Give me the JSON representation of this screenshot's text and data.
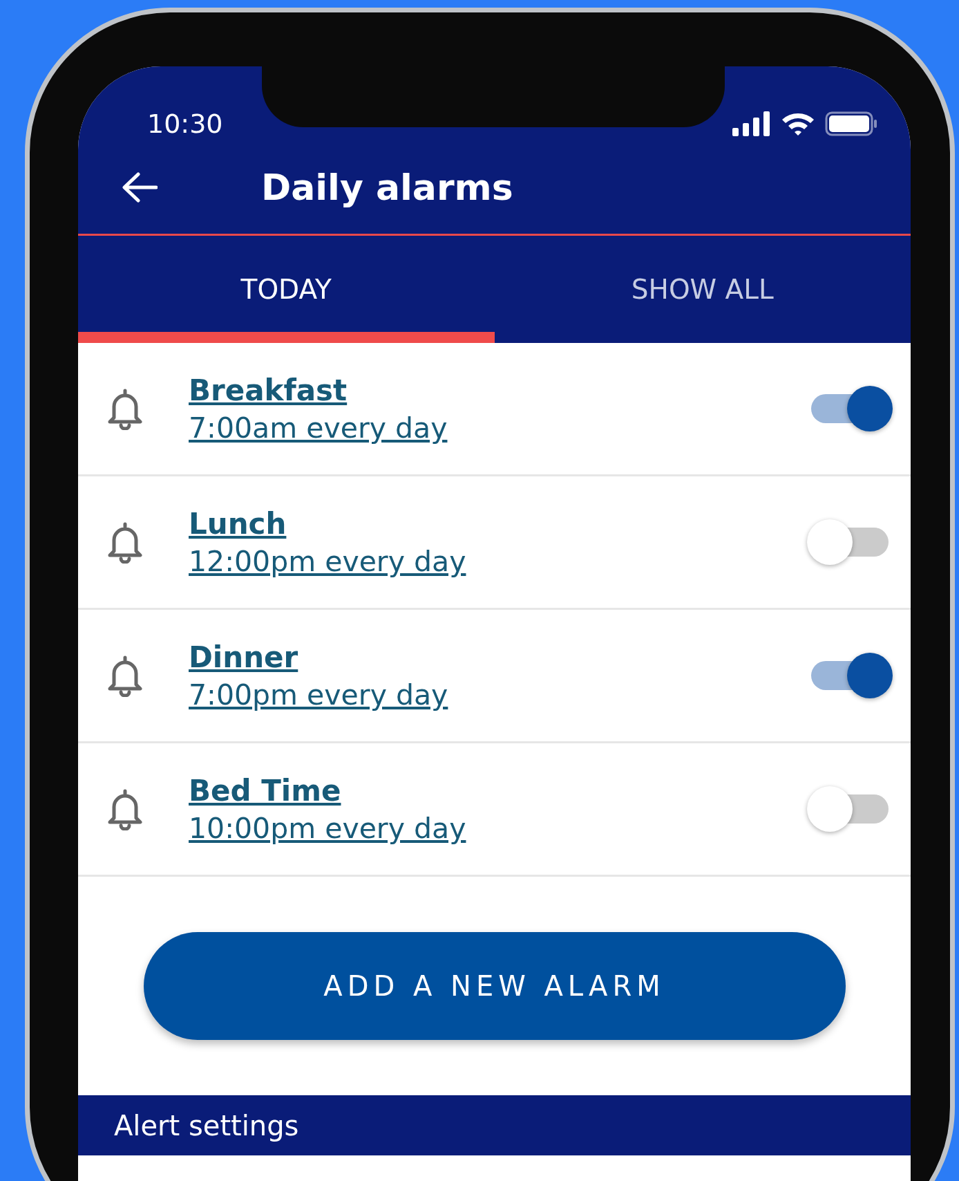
{
  "status_bar": {
    "time": "10:30"
  },
  "header": {
    "title": "Daily alarms"
  },
  "tabs": [
    {
      "label": "TODAY",
      "selected": true
    },
    {
      "label": "SHOW ALL",
      "selected": false
    }
  ],
  "alarms": [
    {
      "title": "Breakfast",
      "schedule": "7:00am every day",
      "on": true
    },
    {
      "title": "Lunch",
      "schedule": "12:00pm every day",
      "on": false
    },
    {
      "title": "Dinner",
      "schedule": "7:00pm every day",
      "on": true
    },
    {
      "title": "Bed Time",
      "schedule": "10:00pm every day",
      "on": false
    }
  ],
  "add_button": {
    "label": "ADD A NEW ALARM"
  },
  "section": {
    "title": "Alert settings"
  }
}
